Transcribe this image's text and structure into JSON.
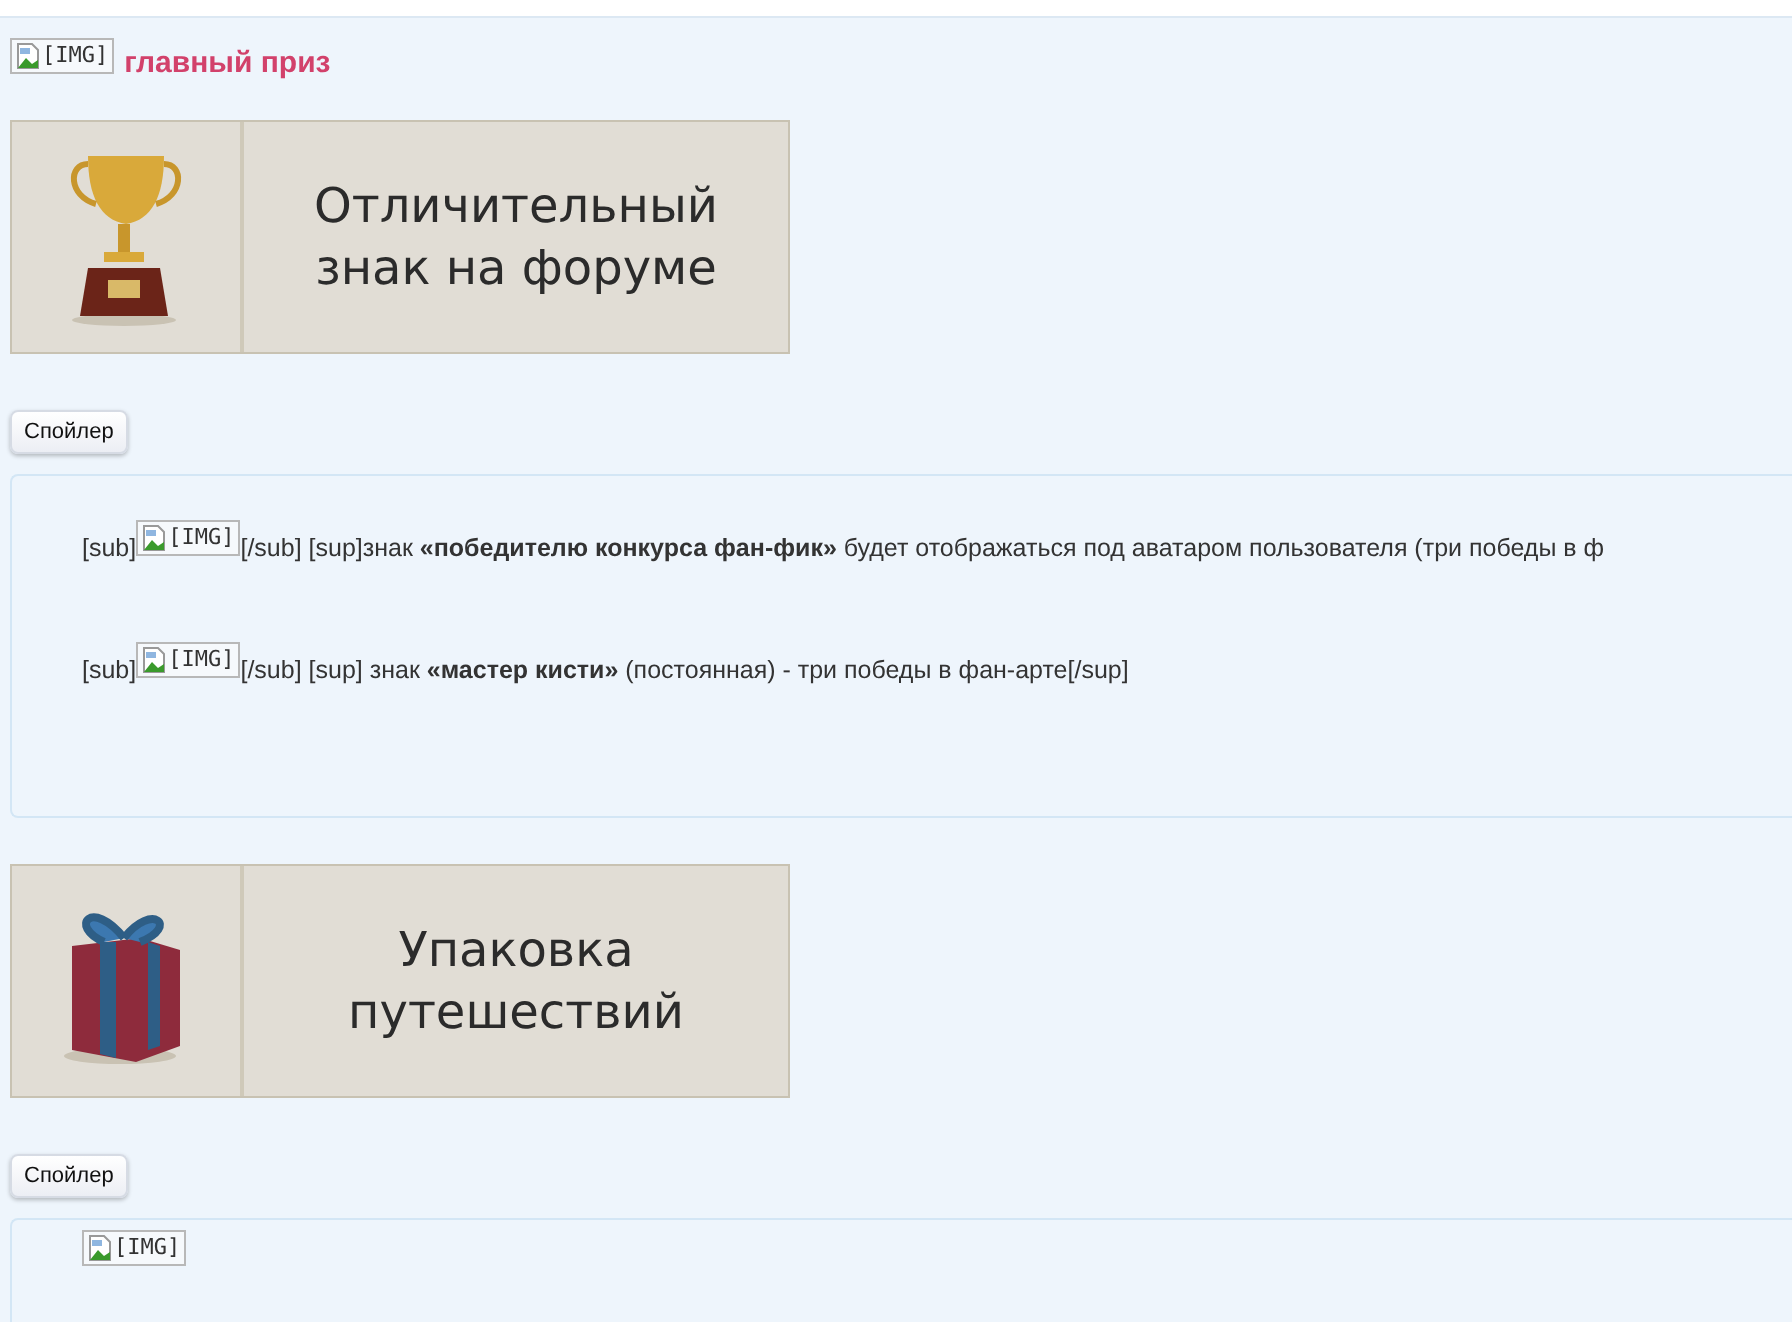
{
  "header": {
    "image_alt": "[IMG]",
    "title": "главный приз"
  },
  "sections": [
    {
      "banner": {
        "kind": "trophy",
        "lines": [
          "Отличительный",
          "знак на форуме"
        ]
      },
      "spoiler_button": "Спойлер",
      "spoiler": {
        "lines": [
          {
            "prefix": "[sub]",
            "image_alt": "[IMG]",
            "text": "[/sub] [sup]знак **«победителю конкурса фан-фик»** будет отображаться под аватаром пользователя (три победы в ф"
          },
          {
            "prefix": "[sub]",
            "image_alt": "[IMG]",
            "text": "[/sub] [sup] знак **«мастер кисти»** (постоянная) - три победы в фан-арте[/sup]"
          }
        ]
      }
    },
    {
      "banner": {
        "kind": "gift",
        "lines": [
          "Упаковка",
          "путешествий"
        ]
      },
      "spoiler_button": "Спойлер",
      "spoiler": {
        "lines": [
          {
            "image_alt": "[IMG]"
          }
        ]
      }
    }
  ]
}
